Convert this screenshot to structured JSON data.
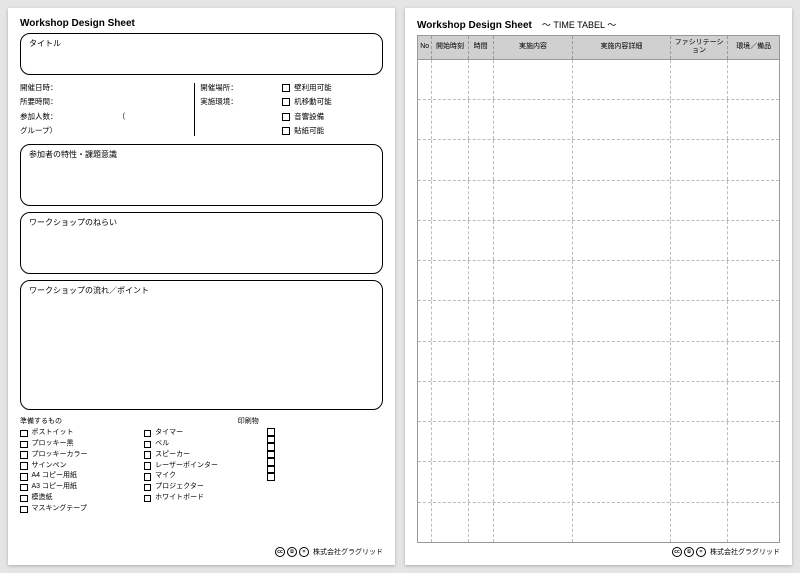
{
  "left": {
    "header": "Workshop Design Sheet",
    "title_label": "タイトル",
    "meta": {
      "date_label": "開催日時：",
      "duration_label": "所要時間：",
      "participants_label": "参加人数：",
      "group_open": "（",
      "group_label": "グループ）",
      "place_label": "開催場所：",
      "env_label": "実施環境："
    },
    "env_checks": [
      "壁利用可能",
      "机移動可能",
      "音響設備",
      "貼紙可能"
    ],
    "characteristics_label": "参加者の特性・課題意識",
    "aim_label": "ワークショップのねらい",
    "flow_label": "ワークショップの流れ／ポイント",
    "prep_label": "準備するもの",
    "print_label": "印刷物",
    "prep_col1": [
      "ポストイット",
      "プロッキー黒",
      "プロッキーカラー",
      "サインペン",
      "A4 コピー用紙",
      "A3 コピー用紙",
      "模造紙",
      "マスキングテープ"
    ],
    "prep_col2": [
      "タイマー",
      "ベル",
      "スピーカー",
      "レーザーポインター",
      "マイク",
      "プロジェクター",
      "ホワイトボード"
    ]
  },
  "right": {
    "header": "Workshop Design Sheet",
    "subtitle": "〜 TIME TABEL 〜",
    "columns": [
      "No",
      "開始時刻",
      "時間",
      "実施内容",
      "実施内容詳細",
      "ファシリテーション",
      "環境／備品"
    ],
    "rows": 12
  },
  "footer": {
    "cc_marks": [
      "cc",
      "①",
      "="
    ],
    "company": "株式会社グラグリッド"
  }
}
